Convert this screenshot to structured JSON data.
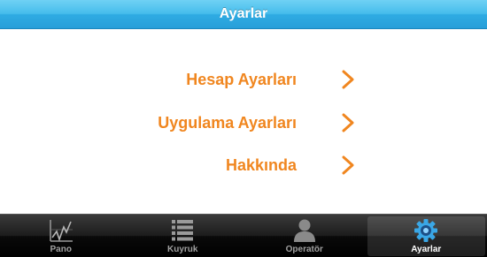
{
  "header": {
    "title": "Ayarlar"
  },
  "menu": {
    "items": [
      {
        "label": "Hesap Ayarları"
      },
      {
        "label": "Uygulama Ayarları"
      },
      {
        "label": "Hakkında"
      }
    ],
    "chevron_icon": "chevron-right-icon"
  },
  "tabbar": {
    "tabs": [
      {
        "label": "Pano",
        "icon": "chart-icon",
        "selected": false
      },
      {
        "label": "Kuyruk",
        "icon": "list-icon",
        "selected": false
      },
      {
        "label": "Operatör",
        "icon": "person-icon",
        "selected": false
      },
      {
        "label": "Ayarlar",
        "icon": "gear-icon",
        "selected": true
      }
    ]
  },
  "colors": {
    "header_blue": "#2fabe3",
    "accent_orange": "#f0861f",
    "tabbar_black": "#000000",
    "tab_label_inactive": "#a0a0a0",
    "tab_label_active": "#ffffff"
  }
}
